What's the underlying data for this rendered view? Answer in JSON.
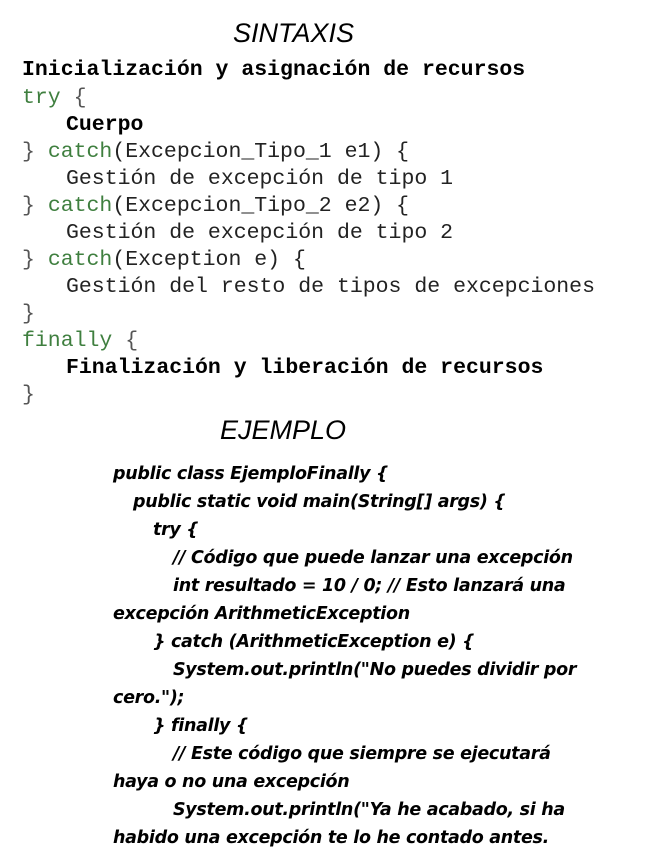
{
  "syntax_title": "SINTAXIS",
  "syntax": {
    "l1": "Inicialización y asignación de recursos",
    "l2_kw": "try",
    "l2_br": " {",
    "l3": "Cuerpo",
    "l4_br": "} ",
    "l4_kw": "catch",
    "l4_rest": "(Excepcion_Tipo_1 e1) {",
    "l5": "Gestión de excepción de tipo 1",
    "l6_br": "} ",
    "l6_kw": "catch",
    "l6_rest": "(Excepcion_Tipo_2 e2) {",
    "l7": "Gestión de excepción de tipo 2",
    "l8_br": "} ",
    "l8_kw": "catch",
    "l8_rest": "(Exception e) {",
    "l9": "Gestión del resto de tipos de excepciones",
    "l10": "}",
    "l11_kw": "finally",
    "l11_br": " {",
    "l12": "Finalización y liberación de recursos",
    "l13": "}"
  },
  "example_title": "EJEMPLO",
  "example": [
    "public class EjemploFinally {",
    "public static void main(String[] args) {",
    "try {",
    "// Código que puede lanzar una excepción",
    "int resultado = 10 / 0; // Esto lanzará una",
    "excepción ArithmeticException",
    "} catch (ArithmeticException e) {",
    "System.out.println(\"No puedes dividir por",
    "cero.\");",
    "} finally {",
    "// Este código que siempre se ejecutará",
    "haya o no una excepción",
    "System.out.println(\"Ya he acabado, si ha",
    "habido una excepción te lo he contado antes."
  ]
}
